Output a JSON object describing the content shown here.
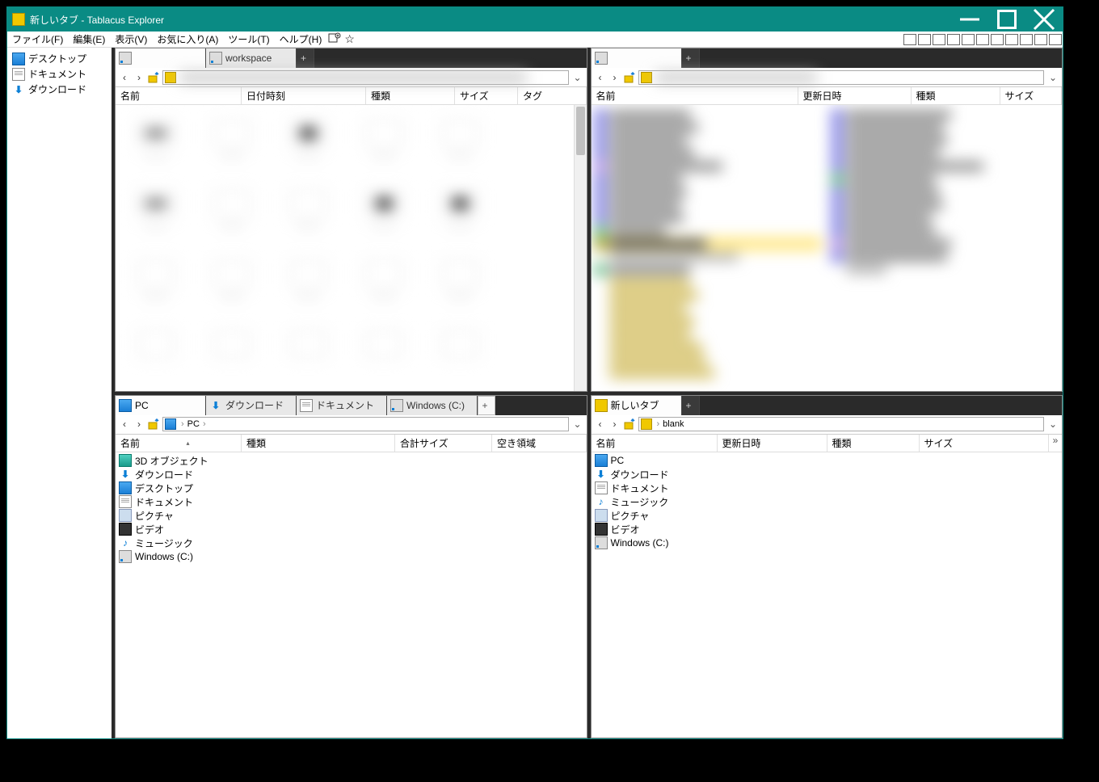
{
  "window": {
    "title": "新しいタブ - Tablacus Explorer"
  },
  "menu": {
    "file": "ファイル(F)",
    "edit": "編集(E)",
    "view": "表示(V)",
    "favorites": "お気に入り(A)",
    "tools": "ツール(T)",
    "help": "ヘルプ(H)"
  },
  "sidebar": {
    "items": [
      {
        "label": "デスクトップ",
        "icon": "desktop"
      },
      {
        "label": "ドキュメント",
        "icon": "doc"
      },
      {
        "label": "ダウンロード",
        "icon": "download"
      }
    ]
  },
  "panes": {
    "tl": {
      "tabs": [
        {
          "label": "",
          "icon": "drive",
          "active": true
        },
        {
          "label": "workspace",
          "icon": "drive",
          "active": false
        }
      ],
      "headers": {
        "name": "名前",
        "date": "日付時刻",
        "type": "種類",
        "size": "サイズ",
        "tag": "タグ"
      }
    },
    "tr": {
      "tabs": [
        {
          "label": "",
          "icon": "drive",
          "active": true
        }
      ],
      "headers": {
        "name": "名前",
        "date": "更新日時",
        "type": "種類",
        "size": "サイズ"
      }
    },
    "bl": {
      "tabs": [
        {
          "label": "PC",
          "icon": "pc",
          "active": true
        },
        {
          "label": "ダウンロード",
          "icon": "download",
          "active": false
        },
        {
          "label": "ドキュメント",
          "icon": "doc",
          "active": false
        },
        {
          "label": "Windows (C:)",
          "icon": "drive",
          "active": false
        }
      ],
      "breadcrumb": "PC",
      "headers": {
        "name": "名前",
        "type": "種類",
        "size": "合計サイズ",
        "free": "空き領域"
      },
      "items": [
        {
          "label": "3D オブジェクト",
          "icon": "cube"
        },
        {
          "label": "ダウンロード",
          "icon": "download"
        },
        {
          "label": "デスクトップ",
          "icon": "desktop"
        },
        {
          "label": "ドキュメント",
          "icon": "doc"
        },
        {
          "label": "ピクチャ",
          "icon": "pic"
        },
        {
          "label": "ビデオ",
          "icon": "vid"
        },
        {
          "label": "ミュージック",
          "icon": "music"
        },
        {
          "label": "Windows (C:)",
          "icon": "drive"
        }
      ]
    },
    "br": {
      "tabs": [
        {
          "label": "新しいタブ",
          "icon": "folder",
          "active": true
        }
      ],
      "breadcrumb": "blank",
      "headers": {
        "name": "名前",
        "date": "更新日時",
        "type": "種類",
        "size": "サイズ"
      },
      "items": [
        {
          "label": "PC",
          "icon": "pc"
        },
        {
          "label": "ダウンロード",
          "icon": "download"
        },
        {
          "label": "ドキュメント",
          "icon": "doc"
        },
        {
          "label": "ミュージック",
          "icon": "music"
        },
        {
          "label": "ピクチャ",
          "icon": "pic"
        },
        {
          "label": "ビデオ",
          "icon": "vid"
        },
        {
          "label": "Windows (C:)",
          "icon": "drive"
        }
      ]
    }
  },
  "glyphs": {
    "back": "‹",
    "fwd": "›",
    "sep": "›",
    "dd": "⌄",
    "plus": "+",
    "star": "☆",
    "more": "»",
    "sortasc": "▴"
  }
}
